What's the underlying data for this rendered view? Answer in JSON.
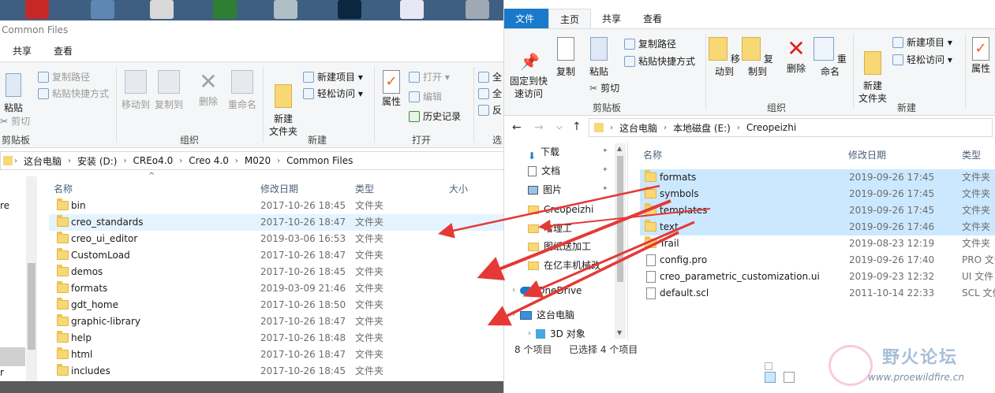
{
  "left": {
    "title": "Common Files",
    "tabs": [
      "共享",
      "查看"
    ],
    "ribbon": {
      "clipboard": {
        "paste": "粘贴",
        "copy_path": "复制路径",
        "paste_shortcut": "粘贴快捷方式",
        "cut": "剪切",
        "label": "剪贴板"
      },
      "organize": {
        "move_to": "移动到",
        "copy_to": "复制到",
        "delete": "删除",
        "rename": "重命名",
        "label": "组织"
      },
      "new": {
        "new_folder": "新建\n文件夹",
        "new_item": "新建项目 ▾",
        "easy_access": "轻松访问 ▾",
        "label": "新建"
      },
      "open": {
        "properties": "属性",
        "open": "打开 ▾",
        "edit": "编辑",
        "history": "历史记录",
        "label": "打开"
      },
      "select": {
        "all": "全",
        "none": "全",
        "invert": "反",
        "label": "选"
      }
    },
    "breadcrumb": [
      "这台电脑",
      "安装 (D:)",
      "CREo4.0",
      "Creo 4.0",
      "M020",
      "Common Files"
    ],
    "columns": {
      "name": "名称",
      "modified": "修改日期",
      "type": "类型",
      "size": "大小"
    },
    "nav_fragment": "re",
    "nav_fragment2": "r",
    "rows": [
      {
        "name": "bin",
        "date": "2017-10-26 18:45",
        "type": "文件夹"
      },
      {
        "name": "creo_standards",
        "date": "2017-10-26 18:47",
        "type": "文件夹"
      },
      {
        "name": "creo_ui_editor",
        "date": "2019-03-06 16:53",
        "type": "文件夹"
      },
      {
        "name": "CustomLoad",
        "date": "2017-10-26 18:47",
        "type": "文件夹"
      },
      {
        "name": "demos",
        "date": "2017-10-26 18:45",
        "type": "文件夹"
      },
      {
        "name": "formats",
        "date": "2019-03-09 21:46",
        "type": "文件夹"
      },
      {
        "name": "gdt_home",
        "date": "2017-10-26 18:50",
        "type": "文件夹"
      },
      {
        "name": "graphic-library",
        "date": "2017-10-26 18:47",
        "type": "文件夹"
      },
      {
        "name": "help",
        "date": "2017-10-26 18:48",
        "type": "文件夹"
      },
      {
        "name": "html",
        "date": "2017-10-26 18:47",
        "type": "文件夹"
      },
      {
        "name": "includes",
        "date": "2017-10-26 18:45",
        "type": "文件夹"
      }
    ]
  },
  "right": {
    "title": "Creopeizhi",
    "tabs": [
      "文件",
      "主页",
      "共享",
      "查看"
    ],
    "ribbon": {
      "clipboard": {
        "pin": "固定到快\n速访问",
        "copy": "复制",
        "paste": "粘贴",
        "copy_path": "复制路径",
        "paste_shortcut": "粘贴快捷方式",
        "cut": "剪切",
        "label": "剪贴板"
      },
      "organize": {
        "move_to": "移动到",
        "copy_to": "复制到",
        "delete": "删除",
        "rename": "重命名",
        "label": "组织"
      },
      "new": {
        "new_folder": "新建\n文件夹",
        "new_item": "新建项目 ▾",
        "easy_access": "轻松访问 ▾",
        "label": "新建"
      },
      "open": {
        "properties": "属性"
      }
    },
    "breadcrumb": [
      "这台电脑",
      "本地磁盘 (E:)",
      "Creopeizhi"
    ],
    "nav": [
      {
        "label": "下载",
        "icon": "download-icon",
        "pin": true
      },
      {
        "label": "文档",
        "icon": "document-icon",
        "pin": true
      },
      {
        "label": "图片",
        "icon": "picture-icon",
        "pin": true
      },
      {
        "label": "Creopeizhi",
        "icon": "folder-icon",
        "pin": false
      },
      {
        "label": "哈理工",
        "icon": "folder-icon",
        "pin": false
      },
      {
        "label": "图纸送加工",
        "icon": "folder-icon",
        "pin": false
      },
      {
        "label": "在亿丰机械改",
        "icon": "folder-icon",
        "pin": false
      },
      {
        "label": "OneDrive",
        "icon": "cloud-icon",
        "pin": false
      },
      {
        "label": "这台电脑",
        "icon": "computer-icon",
        "pin": false
      },
      {
        "label": "3D 对象",
        "icon": "cube-icon",
        "pin": false
      }
    ],
    "columns": {
      "name": "名称",
      "modified": "修改日期",
      "type": "类型"
    },
    "rows": [
      {
        "name": "formats",
        "date": "2019-09-26 17:45",
        "type": "文件夹",
        "kind": "folder",
        "selected": true
      },
      {
        "name": "symbols",
        "date": "2019-09-26 17:45",
        "type": "文件夹",
        "kind": "folder",
        "selected": true
      },
      {
        "name": "templates",
        "date": "2019-09-26 17:45",
        "type": "文件夹",
        "kind": "folder",
        "selected": true
      },
      {
        "name": "text",
        "date": "2019-09-26 17:46",
        "type": "文件夹",
        "kind": "folder",
        "selected": true
      },
      {
        "name": "Trail",
        "date": "2019-08-23 12:19",
        "type": "文件夹",
        "kind": "folder",
        "selected": false
      },
      {
        "name": "config.pro",
        "date": "2019-09-26 17:40",
        "type": "PRO 文件",
        "kind": "file",
        "selected": false
      },
      {
        "name": "creo_parametric_customization.ui",
        "date": "2019-09-23 12:32",
        "type": "UI 文件",
        "kind": "file",
        "selected": false
      },
      {
        "name": "default.scl",
        "date": "2011-10-14 22:33",
        "type": "SCL 文件",
        "kind": "file",
        "selected": false
      }
    ],
    "status": {
      "count": "8 个项目",
      "selected": "已选择 4 个项目"
    }
  },
  "watermark": {
    "title": "野火论坛",
    "url": "www.proewildfire.cn"
  },
  "colors": {
    "file_tab": "#1979ca",
    "selection": "#cce8ff",
    "arrow": "#e53935",
    "folder": "#f8d775"
  }
}
